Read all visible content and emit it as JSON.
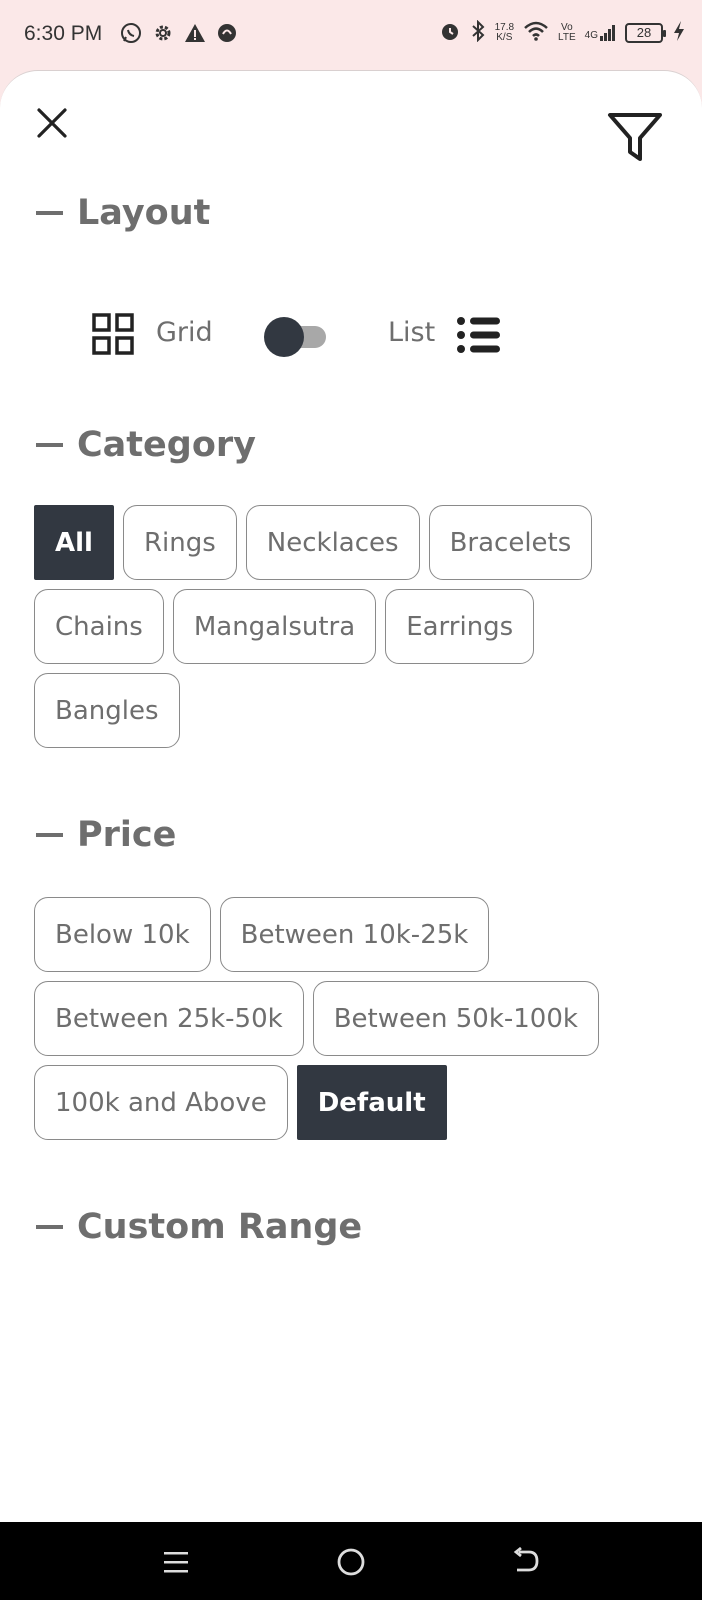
{
  "status_bar": {
    "time": "6:30 PM",
    "left_icons": [
      "whatsapp-icon",
      "settings-icon",
      "warning-icon",
      "notification-icon"
    ],
    "net_speed_value": "17.8",
    "net_speed_unit": "K/S",
    "volte_top": "Vo",
    "volte_bottom": "LTE",
    "signal_label": "4G",
    "battery": "28"
  },
  "header": {
    "close_icon": "close-icon",
    "filter_icon": "filter-icon"
  },
  "layout": {
    "title": "Layout",
    "grid_label": "Grid",
    "list_label": "List",
    "toggle_on": false
  },
  "category": {
    "title": "Category",
    "items": [
      {
        "label": "All",
        "selected": true
      },
      {
        "label": "Rings",
        "selected": false
      },
      {
        "label": "Necklaces",
        "selected": false
      },
      {
        "label": "Bracelets",
        "selected": false
      },
      {
        "label": "Chains",
        "selected": false
      },
      {
        "label": "Mangalsutra",
        "selected": false
      },
      {
        "label": "Earrings",
        "selected": false
      },
      {
        "label": "Bangles",
        "selected": false
      }
    ]
  },
  "price": {
    "title": "Price",
    "items": [
      {
        "label": "Below 10k",
        "selected": false
      },
      {
        "label": "Between 10k-25k",
        "selected": false
      },
      {
        "label": "Between 25k-50k",
        "selected": false
      },
      {
        "label": "Between 50k-100k",
        "selected": false
      },
      {
        "label": "100k and Above",
        "selected": false
      },
      {
        "label": "Default",
        "selected": true
      }
    ]
  },
  "custom_range": {
    "title": "Custom Range"
  },
  "colors": {
    "accent_dark": "#323841",
    "text_gray": "#6e6e6e",
    "status_bg": "#fbe8e8"
  }
}
